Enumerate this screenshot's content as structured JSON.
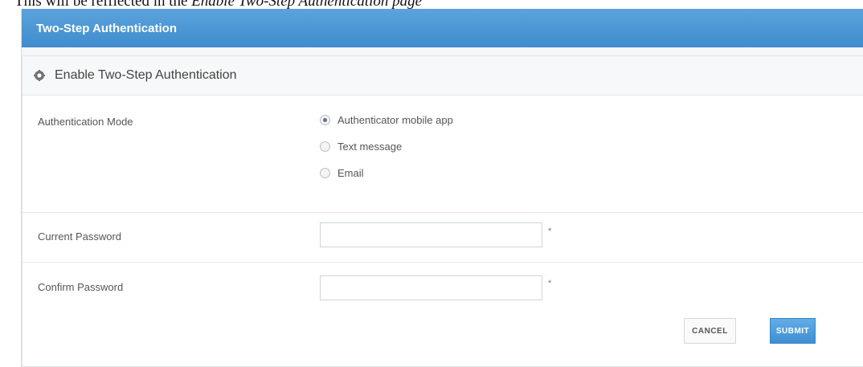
{
  "caption": {
    "prefix": "This will be refflected in the ",
    "emphasis": "Enable Two-Step Authentication page"
  },
  "panel": {
    "title": "Two-Step Authentication"
  },
  "section": {
    "icon": "gear-icon",
    "title": "Enable Two-Step Authentication"
  },
  "auth_mode": {
    "label": "Authentication Mode",
    "options": [
      {
        "label": "Authenticator mobile app",
        "selected": true
      },
      {
        "label": "Text message",
        "selected": false
      },
      {
        "label": "Email",
        "selected": false
      }
    ]
  },
  "current_password": {
    "label": "Current Password",
    "value": "",
    "required_mark": "*"
  },
  "confirm_password": {
    "label": "Confirm Password",
    "value": "",
    "required_mark": "*"
  },
  "buttons": {
    "cancel": "CANCEL",
    "submit": "SUBMIT"
  },
  "colors": {
    "header_blue": "#4a97d6",
    "submit_blue": "#4a9be0"
  }
}
